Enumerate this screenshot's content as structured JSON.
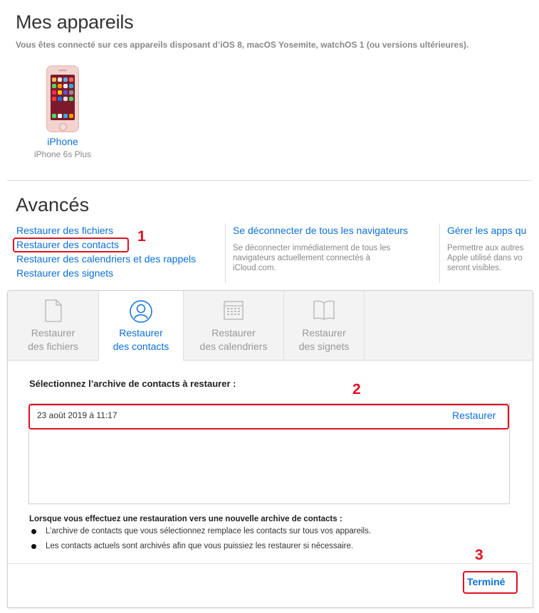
{
  "devices": {
    "title": "Mes appareils",
    "subtitle": "Vous êtes connecté sur ces appareils disposant d’iOS 8, macOS Yosemite, watchOS 1 (ou versions ultérieures).",
    "items": [
      {
        "name": "iPhone",
        "model": "iPhone 6s Plus",
        "icon": "iphone-icon"
      }
    ]
  },
  "advanced": {
    "title": "Avancés",
    "restore_links": [
      "Restaurer des fichiers",
      "Restaurer des contacts",
      "Restaurer des calendriers et des rappels",
      "Restaurer des signets"
    ],
    "signout": {
      "label": "Se déconnecter de tous les navigateurs",
      "description": [
        "Se déconnecter immédiatement de tous les",
        "navigateurs actuellement connectés à",
        "iCloud.com."
      ]
    },
    "apps": {
      "label": "Gérer les apps qu",
      "description": [
        "Permettre aux autres",
        "Apple utilisé dans vo",
        "seront visibles."
      ]
    }
  },
  "panel": {
    "tabs": [
      {
        "line1": "Restaurer",
        "line2": "des fichiers",
        "icon": "document-icon",
        "active": false
      },
      {
        "line1": "Restaurer",
        "line2": "des contacts",
        "icon": "contacts-icon",
        "active": true
      },
      {
        "line1": "Restaurer",
        "line2": "des calendriers",
        "icon": "calendar-icon",
        "active": false
      },
      {
        "line1": "Restaurer",
        "line2": "des signets",
        "icon": "bookmarks-icon",
        "active": false
      }
    ],
    "select_title": "Sélectionnez l’archive de contacts à restaurer :",
    "archives": [
      {
        "date": "23 août 2019 à 11:17",
        "action": "Restaurer"
      }
    ],
    "note_title": "Lorsque vous effectuez une restauration vers une nouvelle archive de contacts :",
    "notes": [
      "L’archive de contacts que vous sélectionnez remplace les contacts sur tous vos appareils.",
      "Les contacts actuels sont archivés afin que vous puissiez les restaurer si nécessaire."
    ],
    "done_label": "Terminé"
  },
  "annotations": {
    "markers": [
      "1",
      "2",
      "3"
    ],
    "color": "#e01020"
  },
  "colors": {
    "link": "#0b70d9",
    "muted": "#888888",
    "tabbar": "#f3f3f3"
  }
}
